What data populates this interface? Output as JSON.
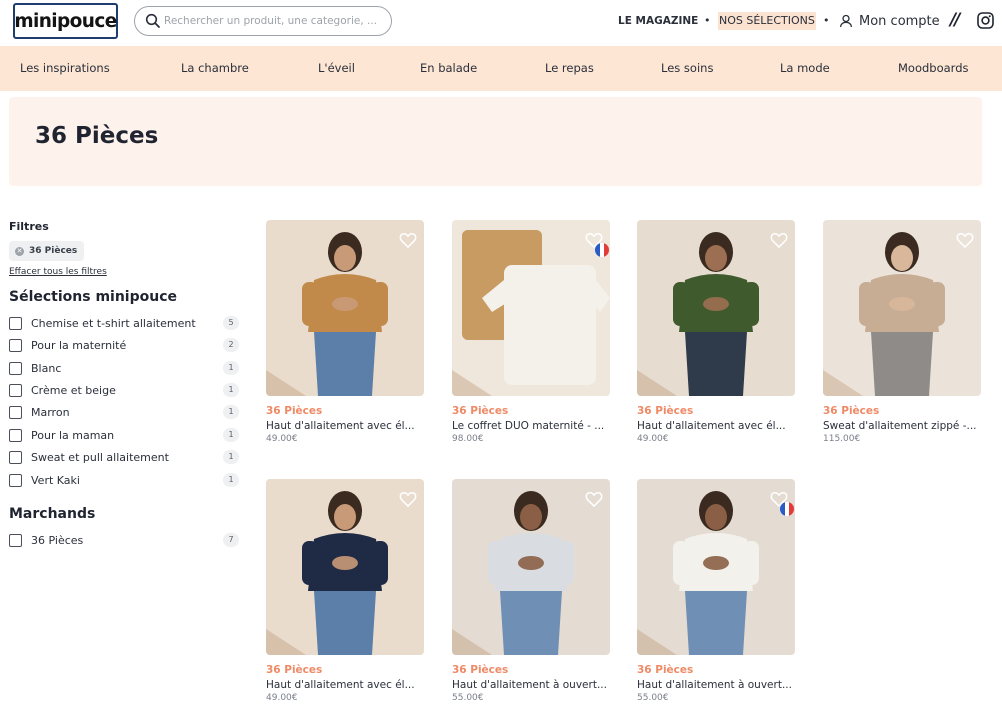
{
  "header": {
    "logo": "minipouce",
    "search_placeholder": "Rechercher un produit, une categorie, ...",
    "magazine": "LE MAGAZINE",
    "selections": "NOS SÉLECTIONS",
    "dot": "•",
    "account": "Mon compte",
    "slashes": "//"
  },
  "categories": [
    "Les inspirations",
    "La chambre",
    "L'éveil",
    "En balade",
    "Le repas",
    "Les soins",
    "La mode",
    "Moodboards"
  ],
  "page_title": "36 Pièces",
  "sidebar": {
    "filters_title": "Filtres",
    "active_chip": "36 Pièces",
    "clear_all": "Effacer tous les filtres",
    "selections_title": "Sélections minipouce",
    "selections": [
      {
        "label": "Chemise et t-shirt allaitement",
        "count": "5"
      },
      {
        "label": "Pour la maternité",
        "count": "2"
      },
      {
        "label": "Blanc",
        "count": "1"
      },
      {
        "label": "Crème et beige",
        "count": "1"
      },
      {
        "label": "Marron",
        "count": "1"
      },
      {
        "label": "Pour la maman",
        "count": "1"
      },
      {
        "label": "Sweat et pull allaitement",
        "count": "1"
      },
      {
        "label": "Vert Kaki",
        "count": "1"
      }
    ],
    "merchants_title": "Marchands",
    "merchants": [
      {
        "label": "36 Pièces",
        "count": "7"
      }
    ]
  },
  "products": [
    {
      "brand": "36 Pièces",
      "name": "Haut d'allaitement avec él...",
      "price": "49.00€",
      "flag": false,
      "top_color": "#c28a4a",
      "bottom_color": "#5b7fa8",
      "skin": "#c99a78",
      "bg": "#e9dccd"
    },
    {
      "brand": "36 Pièces",
      "name": "Le coffret DUO maternité - ...",
      "price": "98.00€",
      "flag": true,
      "top_color": "#c79b62",
      "bottom_color": "#f4f1ea",
      "skin": "#e8dfd3",
      "bg": "#efe7dc"
    },
    {
      "brand": "36 Pièces",
      "name": "Haut d'allaitement avec él...",
      "price": "49.00€",
      "flag": false,
      "top_color": "#3f5a2c",
      "bottom_color": "#2f3a4a",
      "skin": "#9c6f52",
      "bg": "#e6dccf"
    },
    {
      "brand": "36 Pièces",
      "name": "Sweat d'allaitement zippé -...",
      "price": "115.00€",
      "flag": false,
      "top_color": "#c6ad93",
      "bottom_color": "#8e8b88",
      "skin": "#d8b79b",
      "bg": "#ebe3da"
    },
    {
      "brand": "36 Pièces",
      "name": "Haut d'allaitement avec él...",
      "price": "49.00€",
      "flag": false,
      "top_color": "#1f2a44",
      "bottom_color": "#5b7fa8",
      "skin": "#c99a78",
      "bg": "#e9dccd"
    },
    {
      "brand": "36 Pièces",
      "name": "Haut d'allaitement à ouvert...",
      "price": "55.00€",
      "flag": false,
      "top_color": "#d9dde1",
      "bottom_color": "#6f8fb5",
      "skin": "#8a5f45",
      "bg": "#e4dcd2"
    },
    {
      "brand": "36 Pièces",
      "name": "Haut d'allaitement à ouvert...",
      "price": "55.00€",
      "flag": true,
      "top_color": "#f3f1ec",
      "bottom_color": "#6f8fb5",
      "skin": "#8a5f45",
      "bg": "#e4dcd2"
    }
  ],
  "colors": {
    "accent": "#ef8a66",
    "category_bar": "#fde6d4",
    "banner": "#fef3ec",
    "flag_blue": "#2a5bc6",
    "flag_white": "#ffffff",
    "flag_red": "#e23b3b"
  }
}
